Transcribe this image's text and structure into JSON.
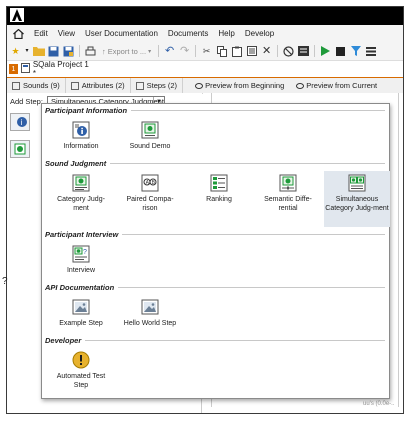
{
  "window": {
    "app_logo": "adobe-logo-icon"
  },
  "menu": {
    "home_icon": "home-icon",
    "items": [
      "Edit",
      "View",
      "User Documentation",
      "Documents",
      "Help",
      "Develop"
    ]
  },
  "toolbar": {
    "export_label": "Export to ...",
    "icons": [
      "star-icon",
      "folder-icon",
      "save-icon",
      "save-as-icon",
      "print-icon",
      "undo-icon",
      "redo-icon",
      "cut-icon",
      "copy-icon",
      "paste-icon",
      "delete-icon",
      "stop-circle-icon",
      "list-icon",
      "play-icon",
      "stop-icon",
      "filter-icon",
      "menu-icon"
    ]
  },
  "project_tab": {
    "pin": "1",
    "title": "SQala Project 1 *"
  },
  "subtabs": [
    {
      "label": "Sounds (9)"
    },
    {
      "label": "Attributes (2)"
    },
    {
      "label": "Steps (2)"
    }
  ],
  "preview": {
    "from_beginning": "Preview from Beginning",
    "from_current": "Preview from Current"
  },
  "add_step": {
    "label": "Add Step:",
    "value": "Simultaneous Category Judgment"
  },
  "right_hint": "uu's (0.0e-..",
  "groups": [
    {
      "title": "Participant Information",
      "items": [
        {
          "label": "Information",
          "icon": "information-icon"
        },
        {
          "label": "Sound Demo",
          "icon": "sound-demo-icon"
        }
      ]
    },
    {
      "title": "Sound Judgment",
      "items": [
        {
          "label": "Category Judg-ment",
          "icon": "category-judgment-icon"
        },
        {
          "label": "Paired Compa-rison",
          "icon": "paired-comparison-icon"
        },
        {
          "label": "Ranking",
          "icon": "ranking-icon"
        },
        {
          "label": "Semantic Diffe-rential",
          "icon": "semantic-differential-icon"
        },
        {
          "label": "Simultaneous Category Judg-ment",
          "icon": "simultaneous-category-judgment-icon"
        }
      ]
    },
    {
      "title": "Participant Interview",
      "items": [
        {
          "label": "Interview",
          "icon": "interview-icon"
        }
      ]
    },
    {
      "title": "API Documentation",
      "items": [
        {
          "label": "Example Step",
          "icon": "image-icon"
        },
        {
          "label": "Hello World Step",
          "icon": "image-icon"
        }
      ]
    },
    {
      "title": "Developer",
      "items": [
        {
          "label": "Automated Test Step",
          "icon": "warning-icon"
        }
      ]
    }
  ],
  "colors": {
    "accent": "#d86b00",
    "selection": "#e1e7ee",
    "titlebar": "#000000"
  }
}
